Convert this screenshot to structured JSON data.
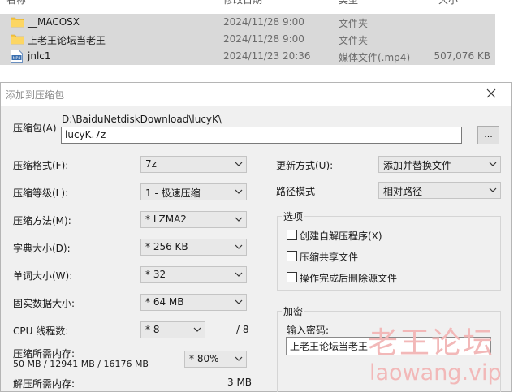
{
  "explorer": {
    "columns": [
      "名称",
      "修改日期",
      "类型",
      "大小"
    ],
    "files": [
      {
        "name": "__MACOSX",
        "date": "2024/11/28 9:00",
        "type": "文件夹",
        "size": "",
        "icon": "folder-icon"
      },
      {
        "name": "上老王论坛当老王",
        "date": "2024/11/28 9:00",
        "type": "文件夹",
        "size": "",
        "icon": "folder-icon"
      },
      {
        "name": "jnlc1",
        "date": "2024/11/23 20:36",
        "type": "媒体文件(.mp4)",
        "size": "507,076 KB",
        "icon": "media-file-icon"
      }
    ]
  },
  "dialog": {
    "title": "添加到压缩包",
    "archive_label": "压缩包(A)",
    "archive_path": "D:\\BaiduNetdiskDownload\\lucyK\\",
    "archive_name": "lucyK.7z",
    "browse_label": "...",
    "format_label": "压缩格式(F):",
    "format_value": "7z",
    "level_label": "压缩等级(L):",
    "level_value": "1 - 极速压缩",
    "method_label": "压缩方法(M):",
    "method_value": "* LZMA2",
    "dict_label": "字典大小(D):",
    "dict_value": "* 256 KB",
    "word_label": "单词大小(W):",
    "word_value": "* 32",
    "solid_label": "固实数据大小:",
    "solid_value": "* 64 MB",
    "threads_label": "CPU 线程数:",
    "threads_value": "* 8",
    "threads_max": "/ 8",
    "mem_compress_label": "压缩所需内存:",
    "mem_compress_value": "50 MB / 12941 MB / 16176 MB",
    "mem_percent_value": "* 80%",
    "mem_decompress_label": "解压所需内存:",
    "mem_decompress_value": "3 MB",
    "update_label": "更新方式(U):",
    "update_value": "添加并替换文件",
    "path_label": "路径模式",
    "path_value": "相对路径",
    "options_title": "选项",
    "opt_sfx": "创建自解压程序(X)",
    "opt_shared": "压缩共享文件",
    "opt_delete": "操作完成后删除源文件",
    "encrypt_title": "加密",
    "password_label": "输入密码:",
    "password_value": "上老王论坛当老王"
  },
  "watermark": {
    "text": "老王论坛",
    "url": "laowang.vip"
  }
}
